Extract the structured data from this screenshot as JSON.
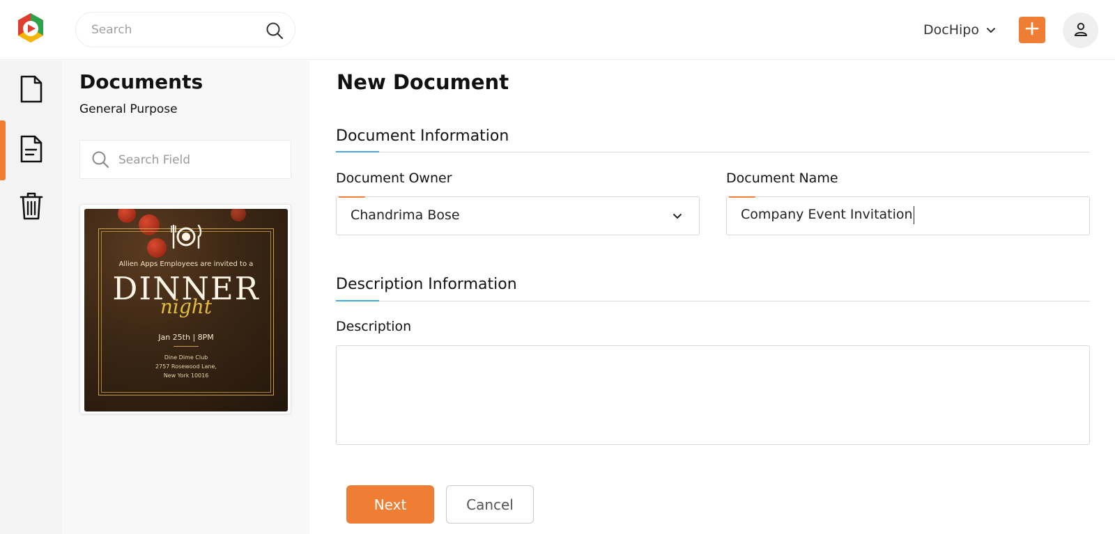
{
  "header": {
    "logo_icon": "dochipo-logo-icon",
    "search": {
      "placeholder": "Search",
      "icon": "search-icon"
    },
    "workspace": {
      "label": "DocHipo",
      "icon": "chevron-down-icon"
    },
    "add_button": {
      "icon": "plus-icon",
      "color": "#ef7e34"
    },
    "avatar": {
      "icon": "user-icon"
    }
  },
  "rail": {
    "items": [
      {
        "icon": "blank-document-icon",
        "active": false
      },
      {
        "icon": "text-document-icon",
        "active": true
      },
      {
        "icon": "trash-icon",
        "active": false
      }
    ],
    "accent_color": "#ef7e34"
  },
  "panel": {
    "title": "Documents",
    "subtitle": "General Purpose",
    "search": {
      "placeholder": "Search Field",
      "icon": "search-icon"
    },
    "template_card": {
      "invite_line": "Allien Apps Employees are invited to a",
      "headline": "DINNER",
      "script_word": "night",
      "date_line": "Jan 25th | 8PM",
      "venue_lines": [
        "Dine Dime Club",
        "2757 Rosewood Lane,",
        "New York 10016"
      ]
    }
  },
  "main": {
    "title": "New Document",
    "document_info": {
      "section_title": "Document Information",
      "owner": {
        "label": "Document Owner",
        "value": "Chandrima Bose"
      },
      "name": {
        "label": "Document Name",
        "value": "Company Event Invitation"
      }
    },
    "description_info": {
      "section_title": "Description Information",
      "description": {
        "label": "Description",
        "value": ""
      }
    },
    "buttons": {
      "next": "Next",
      "cancel": "Cancel"
    }
  },
  "colors": {
    "accent": "#ef7e34",
    "section_accent": "#4aa8e0"
  }
}
